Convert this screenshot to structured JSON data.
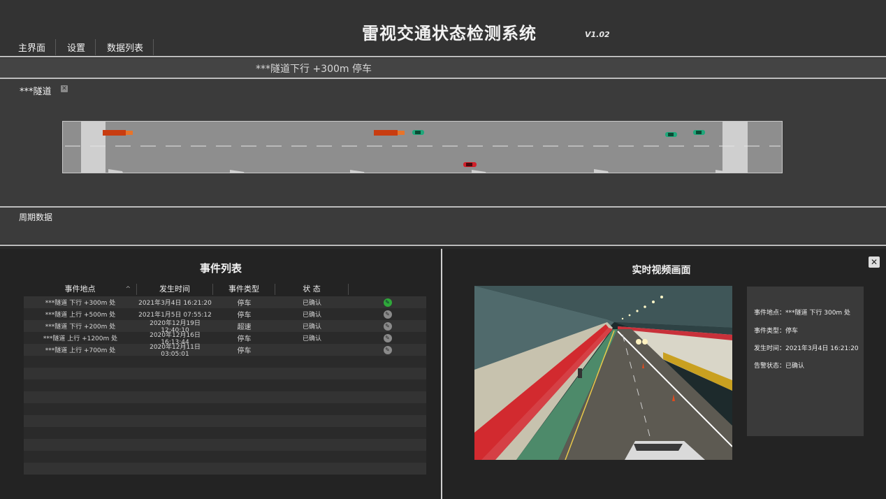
{
  "header": {
    "title": "雷视交通状态检测系统",
    "version": "V1.02",
    "nav": [
      "主界面",
      "设置",
      "数据列表"
    ]
  },
  "alert": {
    "text": "***隧道下行 +300m 停车"
  },
  "tunnel": {
    "name": "***隧道",
    "close_icon": "close-icon"
  },
  "period": {
    "title": "周期数据"
  },
  "events": {
    "title": "事件列表",
    "headers": [
      "事件地点",
      "发生时间",
      "事件类型",
      "状 态"
    ],
    "rows": [
      {
        "location": "***隧道 下行 +300m 处",
        "time": "2021年3月4日 16:21:20",
        "type": "停车",
        "status": "已确认"
      },
      {
        "location": "***隧道 上行 +500m 处",
        "time": "2021年1月5日 07:55:12",
        "type": "停车",
        "status": "已确认"
      },
      {
        "location": "***隧道 下行 +200m 处",
        "time": "2020年12月19日 12:40:10",
        "type": "超速",
        "status": "已确认"
      },
      {
        "location": "***隧道 上行 +1200m 处",
        "time": "2020年12月16日 16:13:44",
        "type": "停车",
        "status": "已确认"
      },
      {
        "location": "***隧道 上行 +700m 处",
        "time": "2020年12月11日  03:05:01",
        "type": "停车",
        "status": ""
      }
    ]
  },
  "video": {
    "title": "实时视频画面",
    "info": {
      "location_label": "事件地点：",
      "location": "***隧道 下行 300m 处",
      "type_label": "事件类型：",
      "type": "停车",
      "time_label": "发生时间：",
      "time": "2021年3月4日 16:21:20",
      "status_label": "告警状态：",
      "status": "已确认"
    }
  },
  "colors": {
    "accent_green": "#2fa83a",
    "truck": "#c83c10",
    "car_green": "#1fa77a",
    "car_red": "#d0202a"
  }
}
